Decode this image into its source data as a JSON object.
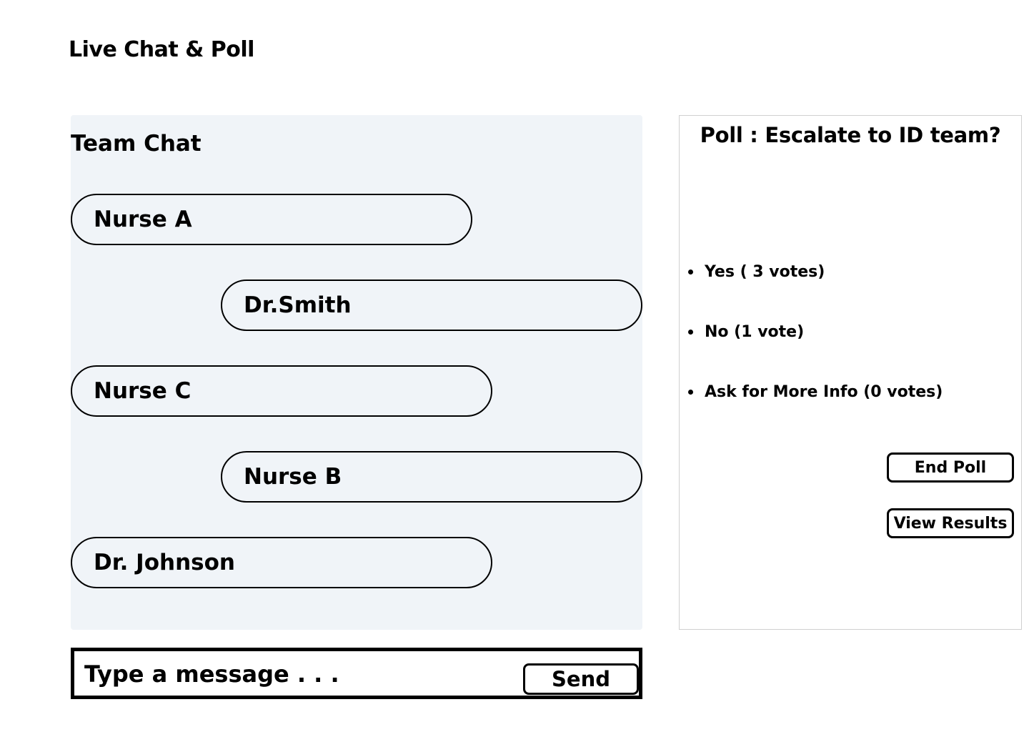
{
  "header": {
    "title": "Live Chat & Poll"
  },
  "chat": {
    "title": "Team Chat",
    "messages": [
      {
        "sender": "Nurse A"
      },
      {
        "sender": "Dr.Smith"
      },
      {
        "sender": "Nurse C"
      },
      {
        "sender": "Nurse B"
      },
      {
        "sender": "Dr. Johnson"
      }
    ]
  },
  "composer": {
    "placeholder": "Type a message . . .",
    "send_label": "Send"
  },
  "poll": {
    "title": "Poll : Escalate to ID team?",
    "options": [
      {
        "label": "Yes ( 3 votes)"
      },
      {
        "label": "No (1 vote)"
      },
      {
        "label": "Ask for More Info (0 votes)"
      }
    ],
    "end_label": "End Poll",
    "results_label": "View Results"
  }
}
